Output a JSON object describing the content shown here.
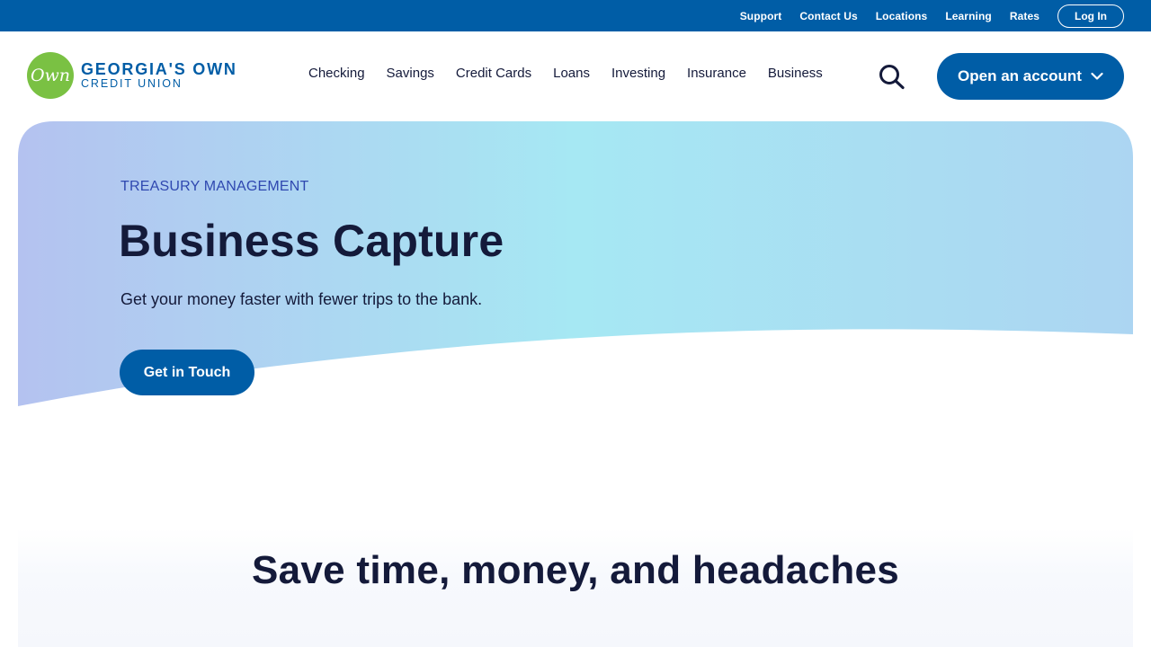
{
  "utility_nav": {
    "links": [
      "Support",
      "Contact Us",
      "Locations",
      "Learning",
      "Rates"
    ],
    "login_label": "Log In"
  },
  "logo": {
    "mark": "Own",
    "line1": "GEORGIA'S OWN",
    "line2": "CREDIT UNION"
  },
  "main_nav": {
    "items": [
      "Checking",
      "Savings",
      "Credit Cards",
      "Loans",
      "Investing",
      "Insurance",
      "Business"
    ],
    "search_icon": "search-icon",
    "open_account_label": "Open an account",
    "open_account_icon": "chevron-down-icon"
  },
  "hero": {
    "eyebrow": "TREASURY MANAGEMENT",
    "title": "Business Capture",
    "subtitle": "Get your money faster with fewer trips to the bank.",
    "cta_label": "Get in Touch"
  },
  "section": {
    "title": "Save time, money, and headaches"
  },
  "colors": {
    "brand_blue": "#005da6",
    "logo_green": "#7ac143",
    "text_dark": "#141a3a",
    "eyebrow_blue": "#2f48b0",
    "hero_gradient_left": "#b4c2f0",
    "hero_gradient_mid": "#a6e8f3",
    "hero_gradient_right": "#acd5f2"
  }
}
